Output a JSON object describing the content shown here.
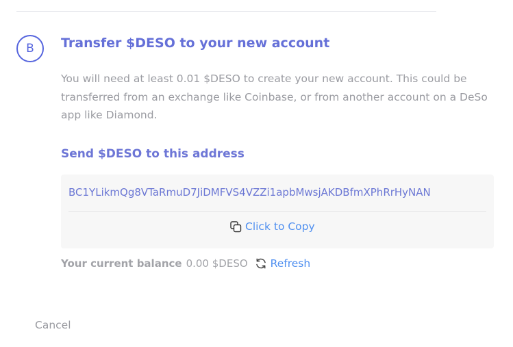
{
  "step": {
    "letter": "B",
    "title": "Transfer $DESO to your new account",
    "description": "You will need at least 0.01 $DESO to create your new account. This could be transferred from an exchange like Coinbase, or from another account on a DeSo app like Diamond."
  },
  "send": {
    "heading": "Send $DESO to this address",
    "address": "BC1YLikmQg8VTaRmuD7JiDMFVS4VZZi1apbMwsjAKDBfmXPhRrHyNAN",
    "copy_label": "Click to Copy",
    "copy_icon": "copy-icon"
  },
  "balance": {
    "label": "Your current balance",
    "value": "0.00 $DESO",
    "refresh_label": "Refresh",
    "refresh_icon": "refresh-icon"
  },
  "cancel_label": "Cancel",
  "colors": {
    "accent": "#5665de",
    "link": "#4f8ff0",
    "muted": "#9a9ba1"
  }
}
